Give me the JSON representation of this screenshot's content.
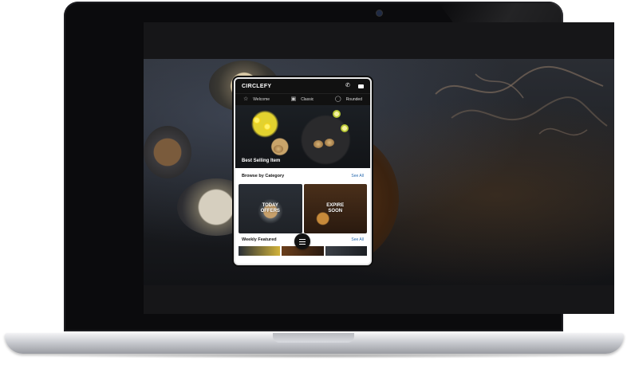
{
  "app": {
    "brand": "CIRCLEFY"
  },
  "tabs": [
    {
      "label": "Welcome",
      "icon": "star-icon"
    },
    {
      "label": "Classic",
      "icon": "photo-icon"
    },
    {
      "label": "Rounded",
      "icon": "circle-icon"
    }
  ],
  "hero": {
    "title": "Best Selling Item"
  },
  "browse": {
    "title": "Browse by Category",
    "see_all": "See All",
    "cards": [
      {
        "label_line1": "TODAY",
        "label_line2": "OFFERS"
      },
      {
        "label_line1": "EXPIRE",
        "label_line2": "SOON"
      }
    ]
  },
  "weekly": {
    "title": "Weekly Featured",
    "see_all": "See All"
  },
  "colors": {
    "header_bg": "#111111",
    "link": "#2b6cb0"
  },
  "icons": {
    "header_left": "phone-icon",
    "header_right": "message-icon",
    "fab": "menu-icon"
  }
}
